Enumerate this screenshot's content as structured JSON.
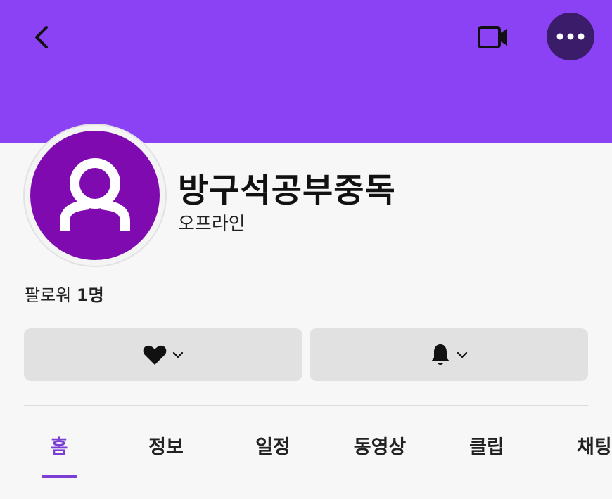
{
  "colors": {
    "banner": "#8b42f5",
    "more_button_bg": "#3b1c6a",
    "avatar_bg": "#7e0ab0",
    "accent": "#7b3fd6",
    "button_bg": "#e1e1e1"
  },
  "header": {
    "back_icon": "chevron-left-icon",
    "video_icon": "video-camera-icon",
    "more_icon": "more-dots-icon"
  },
  "profile": {
    "avatar_icon": "user-silhouette-icon",
    "name": "방구석공부중독",
    "status": "오프라인",
    "followers_label": "팔로워",
    "followers_count": "1명"
  },
  "actions": {
    "follow_icon": "heart-icon",
    "notify_icon": "bell-icon",
    "dropdown_icon": "chevron-down-icon"
  },
  "tabs": [
    {
      "label": "홈",
      "active": true
    },
    {
      "label": "정보",
      "active": false
    },
    {
      "label": "일정",
      "active": false
    },
    {
      "label": "동영상",
      "active": false
    },
    {
      "label": "클립",
      "active": false
    },
    {
      "label": "채팅",
      "active": false
    }
  ]
}
